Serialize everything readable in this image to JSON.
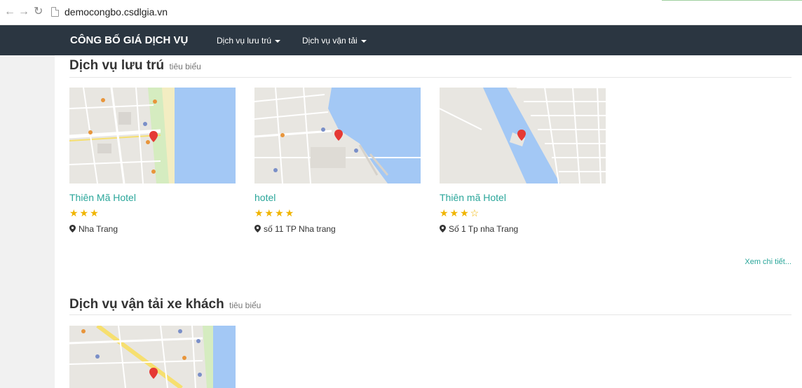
{
  "browser": {
    "url": "democongbo.csdlgia.vn",
    "icons": [
      "back-arrow-icon",
      "forward-arrow-icon",
      "reload-icon",
      "page-icon"
    ]
  },
  "navbar": {
    "brand": "CÔNG BỐ GIÁ DỊCH VỤ",
    "menu": [
      {
        "label": "Dịch vụ lưu trú",
        "icon": "caret-down-icon"
      },
      {
        "label": "Dịch vụ vận tải",
        "icon": "caret-down-icon"
      }
    ]
  },
  "section_lodging": {
    "title": "Dịch vụ lưu trú",
    "subtitle": "tiêu biểu",
    "cards": [
      {
        "name": "Thiên Mã Hotel",
        "stars": "★★★",
        "rating": 3,
        "location": "Nha Trang"
      },
      {
        "name": "hotel",
        "stars": "★★★★",
        "rating": 4,
        "location": "số 11 TP Nha trang"
      },
      {
        "name": "Thiên mã Hotel",
        "stars": "★★★☆",
        "rating": 3,
        "location": "Số 1 Tp nha Trang"
      }
    ],
    "more_link": "Xem chi tiết..."
  },
  "section_transport": {
    "title": "Dịch vụ vận tải xe khách",
    "subtitle": "tiêu biểu"
  },
  "colors": {
    "navbar_bg": "#2b3641",
    "accent": "#2aa69a",
    "star": "#f0b400",
    "water": "#a3c8f5",
    "map_land": "#e8e6e1",
    "pin": "#e53935"
  }
}
